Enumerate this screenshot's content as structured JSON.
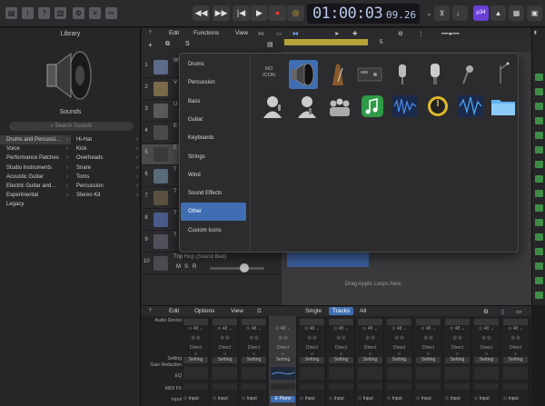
{
  "transport": {
    "time_main": "01:00:03",
    "time_sub": "09.26",
    "badge": "μ34"
  },
  "library": {
    "title": "Library",
    "sounds_label": "Sounds",
    "search_placeholder": "Search Sounds",
    "categories": [
      "Drums and Percussi…",
      "Voice",
      "Performance Patches",
      "Studio Instruments",
      "Acoustic Guitar",
      "Electric Guitar and…",
      "Experimental",
      "Legacy"
    ],
    "subcategories": [
      "Hi-Hat",
      "Kick",
      "Overheads",
      "Snare",
      "Toms",
      "Percussion",
      "Stereo Kit"
    ]
  },
  "tracks_toolbar": {
    "edit": "Edit",
    "functions": "Functions",
    "view": "View",
    "s_label": "S"
  },
  "ruler": {
    "marks": [
      "1",
      "3",
      "5"
    ]
  },
  "tracks": [
    {
      "num": "1",
      "name": "W"
    },
    {
      "num": "2",
      "name": "V"
    },
    {
      "num": "3",
      "name": "U"
    },
    {
      "num": "4",
      "name": "E"
    },
    {
      "num": "5",
      "name": "E"
    },
    {
      "num": "6",
      "name": "T"
    },
    {
      "num": "7",
      "name": "T"
    },
    {
      "num": "8",
      "name": "T"
    },
    {
      "num": "9",
      "name": "T"
    },
    {
      "num": "10",
      "name": "Trip Hop (Sound Bed)",
      "mute": "M",
      "solo": "S",
      "rec": "R"
    }
  ],
  "arrange": {
    "drag_hint": "Drag Apple Loops here."
  },
  "icon_popup": {
    "categories": [
      "Drums",
      "Percussion",
      "Bass",
      "Guitar",
      "Keyboards",
      "Strings",
      "Wind",
      "Sound Effects",
      "Other",
      "Custom Icons"
    ],
    "selected_category": "Other",
    "no_icon_label": "NO ICON"
  },
  "mixer_toolbar": {
    "edit": "Edit",
    "options": "Options",
    "view": "View",
    "single": "Single",
    "tracks": "Tracks",
    "all": "All"
  },
  "mixer": {
    "row_labels": {
      "audio_device": "Audio Device",
      "setting": "Setting",
      "gain_reduction": "Gain Reduction",
      "eq": "EQ",
      "midi_fx": "MIDI FX",
      "input": "Input"
    },
    "direct": "Direct",
    "setting_value": "Setting",
    "khz": "48",
    "input_value": "Input",
    "highlight_input": "E-Piano",
    "strip_count": 12
  }
}
